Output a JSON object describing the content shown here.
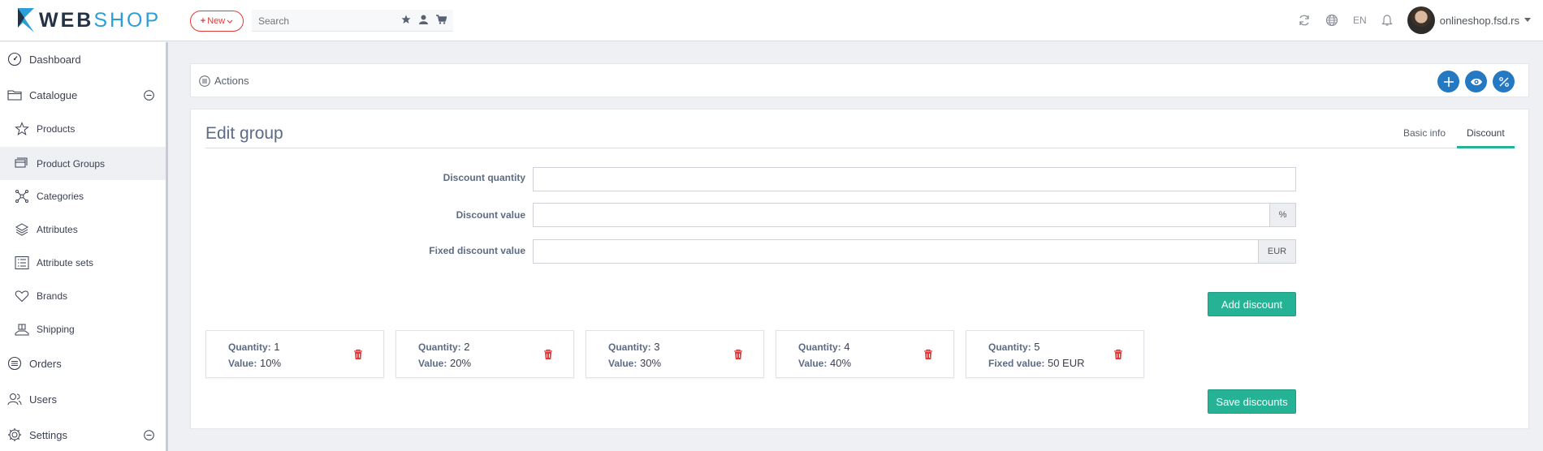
{
  "brand": {
    "web": "WEB",
    "shop": "SHOP"
  },
  "header": {
    "new_label": "New",
    "search_placeholder": "Search",
    "language": "EN",
    "user": "onlineshop.fsd.rs"
  },
  "sidebar": {
    "items": [
      {
        "label": "Dashboard",
        "icon": "dashboard-icon"
      },
      {
        "label": "Catalogue",
        "icon": "folder-icon"
      },
      {
        "label": "Products",
        "icon": "star-icon"
      },
      {
        "label": "Product Groups",
        "icon": "product-groups-icon"
      },
      {
        "label": "Categories",
        "icon": "categories-icon"
      },
      {
        "label": "Attributes",
        "icon": "layers-icon"
      },
      {
        "label": "Attribute sets",
        "icon": "list-icon"
      },
      {
        "label": "Brands",
        "icon": "heart-icon"
      },
      {
        "label": "Shipping",
        "icon": "shipping-icon"
      },
      {
        "label": "Orders",
        "icon": "orders-icon"
      },
      {
        "label": "Users",
        "icon": "users-icon"
      },
      {
        "label": "Settings",
        "icon": "gear-icon"
      }
    ]
  },
  "actions": {
    "label": "Actions"
  },
  "panel": {
    "title": "Edit group",
    "tabs": [
      "Basic info",
      "Discount"
    ],
    "active_tab": "Discount"
  },
  "form": {
    "discount_quantity_label": "Discount quantity",
    "discount_quantity_value": "",
    "discount_value_label": "Discount value",
    "discount_value_value": "",
    "discount_value_addon": "%",
    "fixed_discount_label": "Fixed discount value",
    "fixed_discount_value": "",
    "fixed_discount_addon": "EUR",
    "add_discount_label": "Add discount",
    "save_discounts_label": "Save discounts"
  },
  "discounts": [
    {
      "qty_label": "Quantity:",
      "qty": "1",
      "value_label": "Value:",
      "value": "10%"
    },
    {
      "qty_label": "Quantity:",
      "qty": "2",
      "value_label": "Value:",
      "value": "20%"
    },
    {
      "qty_label": "Quantity:",
      "qty": "3",
      "value_label": "Value:",
      "value": "30%"
    },
    {
      "qty_label": "Quantity:",
      "qty": "4",
      "value_label": "Value:",
      "value": "40%"
    },
    {
      "qty_label": "Quantity:",
      "qty": "5",
      "value_label": "Fixed value:",
      "value": "50 EUR"
    }
  ],
  "colors": {
    "accent_green": "#26b294",
    "accent_blue": "#2578c2",
    "danger_red": "#e23a3a",
    "logo_blue": "#2d9fd8"
  }
}
